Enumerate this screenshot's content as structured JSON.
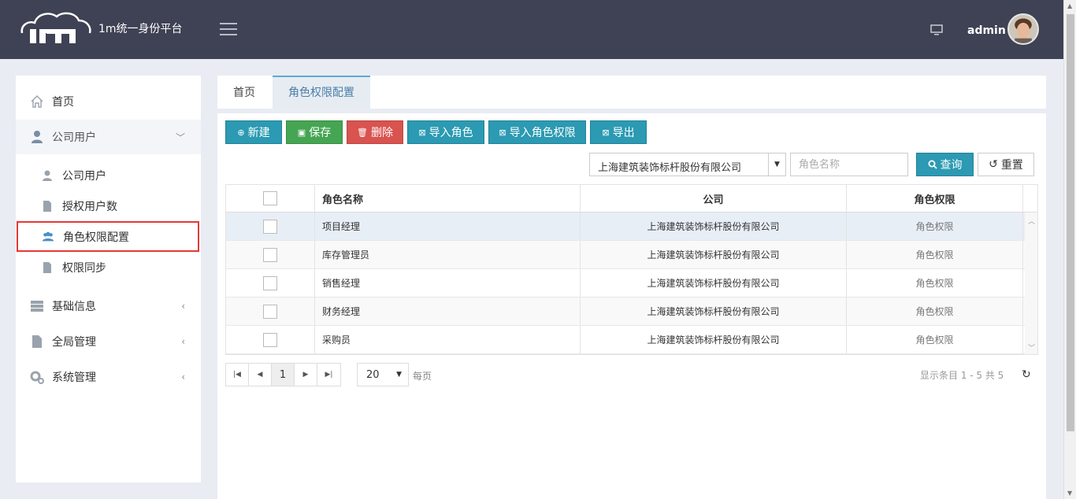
{
  "header": {
    "brand": "1m统一身份平台",
    "user": "admin"
  },
  "sidebar": {
    "items": [
      {
        "label": "首页"
      },
      {
        "label": "公司用户"
      },
      {
        "label": "基础信息"
      },
      {
        "label": "全局管理"
      },
      {
        "label": "系统管理"
      }
    ],
    "sub_items": [
      {
        "label": "公司用户"
      },
      {
        "label": "授权用户数"
      },
      {
        "label": "角色权限配置"
      },
      {
        "label": "权限同步"
      }
    ]
  },
  "tabs": [
    {
      "label": "首页"
    },
    {
      "label": "角色权限配置"
    }
  ],
  "toolbar": {
    "new": "新建",
    "save": "保存",
    "delete": "删除",
    "import_role": "导入角色",
    "import_role_perm": "导入角色权限",
    "export": "导出"
  },
  "filter": {
    "company": "上海建筑装饰标杆股份有限公司",
    "role_placeholder": "角色名称",
    "query": "查询",
    "reset": "重置"
  },
  "table": {
    "headers": {
      "name": "角色名称",
      "company": "公司",
      "perm": "角色权限"
    },
    "rows": [
      {
        "name": "项目经理",
        "company": "上海建筑装饰标杆股份有限公司",
        "perm": "角色权限"
      },
      {
        "name": "库存管理员",
        "company": "上海建筑装饰标杆股份有限公司",
        "perm": "角色权限"
      },
      {
        "name": "销售经理",
        "company": "上海建筑装饰标杆股份有限公司",
        "perm": "角色权限"
      },
      {
        "name": "财务经理",
        "company": "上海建筑装饰标杆股份有限公司",
        "perm": "角色权限"
      },
      {
        "name": "采购员",
        "company": "上海建筑装饰标杆股份有限公司",
        "perm": "角色权限"
      }
    ]
  },
  "pager": {
    "current_page": "1",
    "page_size": "20",
    "per_page_label": "每页",
    "summary": "显示条目 1 - 5 共 5"
  },
  "colors": {
    "header_bg": "#3f4254",
    "accent": "#2b9ab2",
    "save": "#45a553",
    "delete": "#d9534f",
    "highlight": "#e53935"
  }
}
